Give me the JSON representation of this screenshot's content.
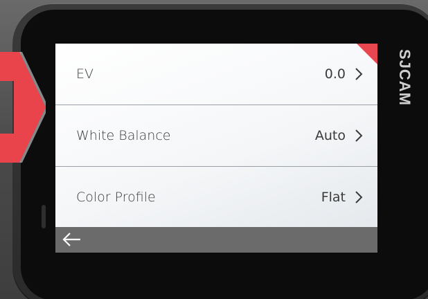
{
  "device": {
    "brand_logo": "SJCAM"
  },
  "menu": {
    "items": [
      {
        "label": "EV",
        "value": "0.0",
        "icon": "chevron-right-icon"
      },
      {
        "label": "White Balance",
        "value": "Auto",
        "icon": "chevron-right-icon"
      },
      {
        "label": "Color Profile",
        "value": "Flat",
        "icon": "chevron-right-icon"
      }
    ]
  },
  "bottom_bar": {
    "back_icon": "arrow-left-icon"
  },
  "colors": {
    "accent_red": "#e8474f",
    "bottom_bar": "#6b6b6b",
    "text": "#3a3a3a"
  }
}
